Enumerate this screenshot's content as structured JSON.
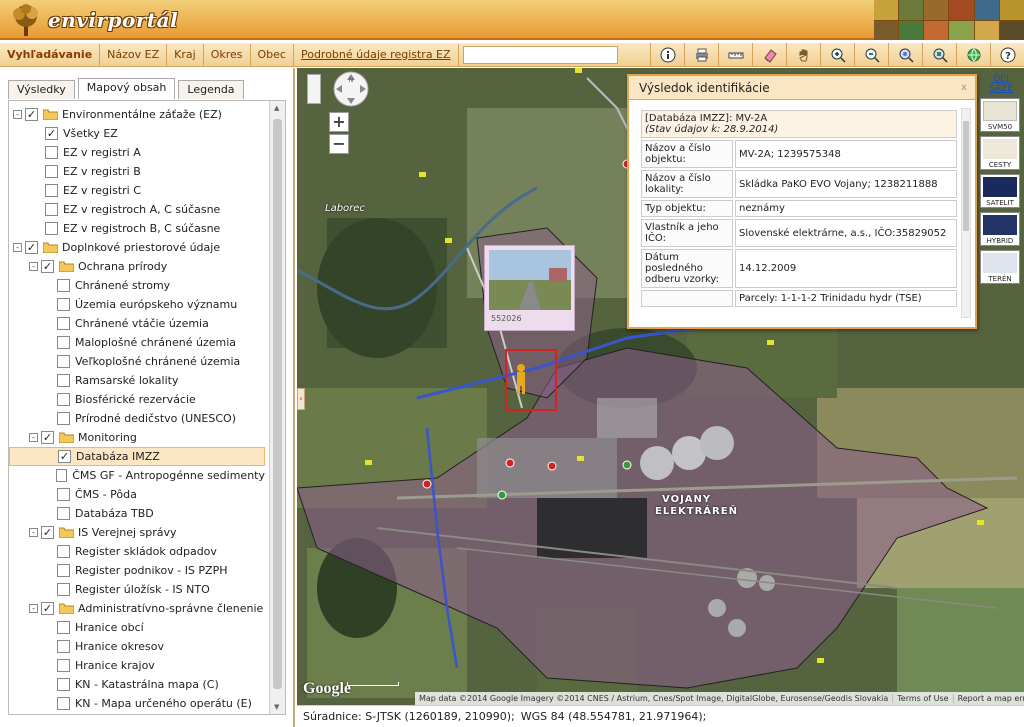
{
  "header": {
    "logo_text": "envirportál"
  },
  "toolbar": {
    "tabs": [
      "Vyhľadávanie",
      "Názov EZ",
      "Kraj",
      "Okres",
      "Obec",
      "Podrobné údaje registra EZ"
    ],
    "search_value": "",
    "tools": [
      "info-icon",
      "print-icon",
      "measure-icon",
      "eraser-icon",
      "pan-hand-icon",
      "zoom-in-icon",
      "zoom-out-icon",
      "zoom-extent-icon",
      "zoom-select-icon",
      "globe-icon",
      "help-icon"
    ]
  },
  "panel": {
    "tabs": [
      "Výsledky",
      "Mapový obsah",
      "Legenda"
    ],
    "active_tab": "Mapový obsah",
    "tree": [
      {
        "label": "Environmentálne záťaže (EZ)",
        "level": 0,
        "expander": "-",
        "checked": true,
        "folder": true
      },
      {
        "label": "Všetky EZ",
        "level": 1,
        "checked": true
      },
      {
        "label": "EZ v registri A",
        "level": 1,
        "checked": false
      },
      {
        "label": "EZ v registri B",
        "level": 1,
        "checked": false
      },
      {
        "label": "EZ v registri C",
        "level": 1,
        "checked": false
      },
      {
        "label": "EZ v registroch A, C súčasne",
        "level": 1,
        "checked": false
      },
      {
        "label": "EZ v registroch B, C súčasne",
        "level": 1,
        "checked": false
      },
      {
        "label": "Doplnkové priestorové údaje",
        "level": 0,
        "expander": "-",
        "checked": true,
        "folder": true
      },
      {
        "label": "Ochrana prírody",
        "level": 1,
        "expander": "-",
        "checked": true,
        "folder": true
      },
      {
        "label": "Chránené stromy",
        "level": 2,
        "checked": false
      },
      {
        "label": "Územia európskeho významu",
        "level": 2,
        "checked": false
      },
      {
        "label": "Chránené vtáčie územia",
        "level": 2,
        "checked": false
      },
      {
        "label": "Maloplošné chránené územia",
        "level": 2,
        "checked": false
      },
      {
        "label": "Veľkoplošné chránené územia",
        "level": 2,
        "checked": false
      },
      {
        "label": "Ramsarské lokality",
        "level": 2,
        "checked": false
      },
      {
        "label": "Biosférické rezervácie",
        "level": 2,
        "checked": false
      },
      {
        "label": "Prírodné dedičstvo (UNESCO)",
        "level": 2,
        "checked": false
      },
      {
        "label": "Monitoring",
        "level": 1,
        "expander": "-",
        "checked": true,
        "folder": true
      },
      {
        "label": "Databáza IMZZ",
        "level": 2,
        "checked": true,
        "selected": true
      },
      {
        "label": "ČMS GF - Antropogénne sedimenty",
        "level": 2,
        "checked": false
      },
      {
        "label": "ČMS - Pôda",
        "level": 2,
        "checked": false
      },
      {
        "label": "Databáza TBD",
        "level": 2,
        "checked": false
      },
      {
        "label": "IS Verejnej správy",
        "level": 1,
        "expander": "-",
        "checked": true,
        "folder": true
      },
      {
        "label": "Register skládok odpadov",
        "level": 2,
        "checked": false
      },
      {
        "label": "Register podnikov - IS PZPH",
        "level": 2,
        "checked": false
      },
      {
        "label": "Register úložísk - IS NTO",
        "level": 2,
        "checked": false
      },
      {
        "label": "Administratívno-správne členenie",
        "level": 1,
        "expander": "-",
        "checked": true,
        "folder": true
      },
      {
        "label": "Hranice obcí",
        "level": 2,
        "checked": false
      },
      {
        "label": "Hranice okresov",
        "level": 2,
        "checked": false
      },
      {
        "label": "Hranice krajov",
        "level": 2,
        "checked": false
      },
      {
        "label": "KN - Katastrálna mapa (C)",
        "level": 2,
        "checked": false
      },
      {
        "label": "KN - Mapa určeného operátu (E)",
        "level": 2,
        "checked": false
      }
    ]
  },
  "map": {
    "more_layers_link": "ĎEJ ŠAZÉ",
    "layers": [
      "SVM50",
      "CESTY",
      "SATELIT",
      "HYBRID",
      "TERÉN"
    ],
    "labels": {
      "river": "Laborec",
      "plant_1": "VOJANY",
      "plant_2": "ELEKTRÁREŇ"
    },
    "photo_number": "552026",
    "google": "Google",
    "attribution": [
      "Map data ©2014 Google Imagery ©2014 CNES / Astrium, Cnes/Spot Image, DigitalGlobe, Eurosense/Geodis Slovakia",
      "Terms of Use",
      "Report a map error"
    ]
  },
  "popup": {
    "title": "Výsledok identifikácie",
    "close": "x",
    "head_line1": "[Databáza IMZZ]: MV-2A",
    "head_line2": "(Stav údajov k: 28.9.2014)",
    "rows": [
      {
        "key": "Názov a číslo objektu:",
        "value": "MV-2A; 1239575348"
      },
      {
        "key": "Názov a číslo lokality:",
        "value": "Skládka PaKO EVO Vojany; 1238211888"
      },
      {
        "key": "Typ objektu:",
        "value": "neznámy"
      },
      {
        "key": "Vlastník a jeho IČO:",
        "value": "Slovenské elektrárne, a.s., IČO:35829052"
      },
      {
        "key": "Dátum posledného odberu vzorky:",
        "value": "14.12.2009"
      },
      {
        "key": "",
        "value": "Parcely: 1-1-1-2 Trinidadu hydr (TSE)"
      }
    ]
  },
  "status": {
    "sjtsk": "Súradnice: S-JTSK (1260189, 210990);",
    "wgs": "WGS 84 (48.554781, 21.971964);"
  },
  "colors": {
    "accent": "#e89a32",
    "toolbar": "#f1cf92",
    "overlay": "#8a5d8c"
  }
}
